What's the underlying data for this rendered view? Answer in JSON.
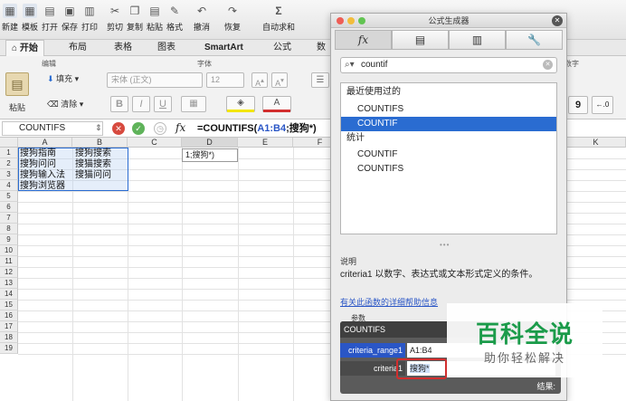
{
  "toolbar": {
    "buttons": [
      "新建",
      "模板",
      "打开",
      "保存",
      "打印",
      "剪切",
      "复制",
      "粘贴",
      "格式",
      "撤消",
      "恢复",
      "自动求和"
    ]
  },
  "ribbon_tabs": [
    "开始",
    "布局",
    "表格",
    "图表",
    "SmartArt",
    "公式",
    "数"
  ],
  "ribbon": {
    "group_edit": "编辑",
    "group_font": "字体",
    "fill_label": "填充",
    "clear_label": "清除",
    "paste_label": "粘贴",
    "font_name": "宋体 (正文)",
    "font_size": "12",
    "bold": "B",
    "italic": "I",
    "underline": "U",
    "number_group": "数字",
    "comma": "9"
  },
  "formula_bar": {
    "name_box": "COUNTIFS",
    "fx": "fx",
    "formula_prefix": "=COUNTIFS(",
    "formula_ref": "A1:B4",
    "formula_suffix": ";搜狗*)"
  },
  "grid": {
    "columns": [
      "A",
      "B",
      "C",
      "D",
      "E",
      "F",
      "K"
    ],
    "rows": [
      "1",
      "2",
      "3",
      "4",
      "5",
      "6",
      "7",
      "8",
      "9",
      "10",
      "11",
      "12",
      "13",
      "14",
      "15",
      "16",
      "17",
      "18",
      "19"
    ],
    "cells": {
      "A1": "搜狗指南",
      "B1": "搜狗搜索",
      "A2": "搜狗问问",
      "B2": "搜猫搜索",
      "A3": "搜狗输入法",
      "B3": "搜猫问问",
      "A4": "搜狗浏览器"
    },
    "edit_tooltip": "1;搜狗*)"
  },
  "panel": {
    "title": "公式生成器",
    "tabs": [
      "fx",
      "▤",
      "▥",
      "🔧"
    ],
    "search_value": "countif",
    "recent_header": "最近使用过的",
    "recent": [
      "COUNTIFS",
      "COUNTIF"
    ],
    "stats_header": "统计",
    "stats": [
      "COUNTIF",
      "COUNTIFS"
    ],
    "desc_header": "说明",
    "description": "criteria1 以数字、表达式或文本形式定义的条件。",
    "help_link": "有关此函数的详细帮助信息",
    "params_header": "参数",
    "func_name": "COUNTIFS",
    "param1_label": "criteria_range1",
    "param1_value": "A1:B4",
    "param2_label": "criteria1",
    "param2_value": "搜狗*",
    "result_label": "结果:"
  },
  "watermark": {
    "title": "百科全说",
    "subtitle": "助你轻松解决"
  },
  "colors": {
    "accent": "#2a6cd1",
    "watermark_green": "#1b9b4a",
    "highlight_red": "#d22e2e"
  }
}
